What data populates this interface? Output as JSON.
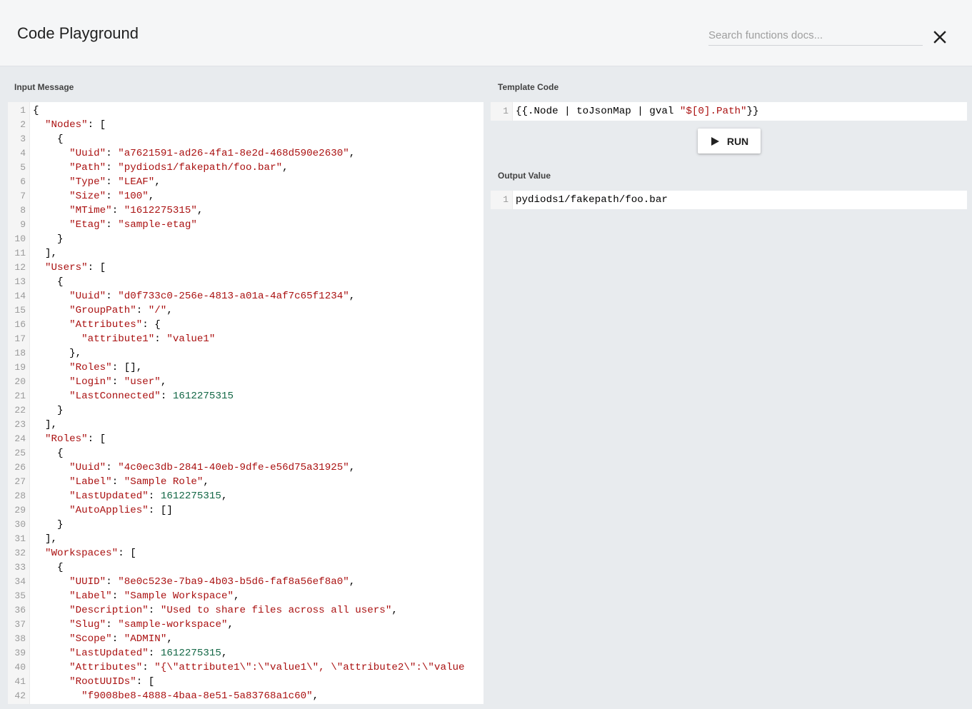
{
  "header": {
    "title": "Code Playground",
    "search_placeholder": "Search functions docs..."
  },
  "input": {
    "label": "Input Message",
    "lines": [
      [
        [
          "p",
          "{"
        ]
      ],
      [
        [
          "p",
          "  "
        ],
        [
          "k",
          "\"Nodes\""
        ],
        [
          "p",
          ": ["
        ]
      ],
      [
        [
          "p",
          "    {"
        ]
      ],
      [
        [
          "p",
          "      "
        ],
        [
          "k",
          "\"Uuid\""
        ],
        [
          "p",
          ": "
        ],
        [
          "s",
          "\"a7621591-ad26-4fa1-8e2d-468d590e2630\""
        ],
        [
          "p",
          ","
        ]
      ],
      [
        [
          "p",
          "      "
        ],
        [
          "k",
          "\"Path\""
        ],
        [
          "p",
          ": "
        ],
        [
          "s",
          "\"pydiods1/fakepath/foo.bar\""
        ],
        [
          "p",
          ","
        ]
      ],
      [
        [
          "p",
          "      "
        ],
        [
          "k",
          "\"Type\""
        ],
        [
          "p",
          ": "
        ],
        [
          "s",
          "\"LEAF\""
        ],
        [
          "p",
          ","
        ]
      ],
      [
        [
          "p",
          "      "
        ],
        [
          "k",
          "\"Size\""
        ],
        [
          "p",
          ": "
        ],
        [
          "s",
          "\"100\""
        ],
        [
          "p",
          ","
        ]
      ],
      [
        [
          "p",
          "      "
        ],
        [
          "k",
          "\"MTime\""
        ],
        [
          "p",
          ": "
        ],
        [
          "s",
          "\"1612275315\""
        ],
        [
          "p",
          ","
        ]
      ],
      [
        [
          "p",
          "      "
        ],
        [
          "k",
          "\"Etag\""
        ],
        [
          "p",
          ": "
        ],
        [
          "s",
          "\"sample-etag\""
        ]
      ],
      [
        [
          "p",
          "    }"
        ]
      ],
      [
        [
          "p",
          "  ],"
        ]
      ],
      [
        [
          "p",
          "  "
        ],
        [
          "k",
          "\"Users\""
        ],
        [
          "p",
          ": ["
        ]
      ],
      [
        [
          "p",
          "    {"
        ]
      ],
      [
        [
          "p",
          "      "
        ],
        [
          "k",
          "\"Uuid\""
        ],
        [
          "p",
          ": "
        ],
        [
          "s",
          "\"d0f733c0-256e-4813-a01a-4af7c65f1234\""
        ],
        [
          "p",
          ","
        ]
      ],
      [
        [
          "p",
          "      "
        ],
        [
          "k",
          "\"GroupPath\""
        ],
        [
          "p",
          ": "
        ],
        [
          "s",
          "\"/\""
        ],
        [
          "p",
          ","
        ]
      ],
      [
        [
          "p",
          "      "
        ],
        [
          "k",
          "\"Attributes\""
        ],
        [
          "p",
          ": {"
        ]
      ],
      [
        [
          "p",
          "        "
        ],
        [
          "k",
          "\"attribute1\""
        ],
        [
          "p",
          ": "
        ],
        [
          "s",
          "\"value1\""
        ]
      ],
      [
        [
          "p",
          "      },"
        ]
      ],
      [
        [
          "p",
          "      "
        ],
        [
          "k",
          "\"Roles\""
        ],
        [
          "p",
          ": [],"
        ]
      ],
      [
        [
          "p",
          "      "
        ],
        [
          "k",
          "\"Login\""
        ],
        [
          "p",
          ": "
        ],
        [
          "s",
          "\"user\""
        ],
        [
          "p",
          ","
        ]
      ],
      [
        [
          "p",
          "      "
        ],
        [
          "k",
          "\"LastConnected\""
        ],
        [
          "p",
          ": "
        ],
        [
          "n",
          "1612275315"
        ]
      ],
      [
        [
          "p",
          "    }"
        ]
      ],
      [
        [
          "p",
          "  ],"
        ]
      ],
      [
        [
          "p",
          "  "
        ],
        [
          "k",
          "\"Roles\""
        ],
        [
          "p",
          ": ["
        ]
      ],
      [
        [
          "p",
          "    {"
        ]
      ],
      [
        [
          "p",
          "      "
        ],
        [
          "k",
          "\"Uuid\""
        ],
        [
          "p",
          ": "
        ],
        [
          "s",
          "\"4c0ec3db-2841-40eb-9dfe-e56d75a31925\""
        ],
        [
          "p",
          ","
        ]
      ],
      [
        [
          "p",
          "      "
        ],
        [
          "k",
          "\"Label\""
        ],
        [
          "p",
          ": "
        ],
        [
          "s",
          "\"Sample Role\""
        ],
        [
          "p",
          ","
        ]
      ],
      [
        [
          "p",
          "      "
        ],
        [
          "k",
          "\"LastUpdated\""
        ],
        [
          "p",
          ": "
        ],
        [
          "n",
          "1612275315"
        ],
        [
          "p",
          ","
        ]
      ],
      [
        [
          "p",
          "      "
        ],
        [
          "k",
          "\"AutoApplies\""
        ],
        [
          "p",
          ": []"
        ]
      ],
      [
        [
          "p",
          "    }"
        ]
      ],
      [
        [
          "p",
          "  ],"
        ]
      ],
      [
        [
          "p",
          "  "
        ],
        [
          "k",
          "\"Workspaces\""
        ],
        [
          "p",
          ": ["
        ]
      ],
      [
        [
          "p",
          "    {"
        ]
      ],
      [
        [
          "p",
          "      "
        ],
        [
          "k",
          "\"UUID\""
        ],
        [
          "p",
          ": "
        ],
        [
          "s",
          "\"8e0c523e-7ba9-4b03-b5d6-faf8a56ef8a0\""
        ],
        [
          "p",
          ","
        ]
      ],
      [
        [
          "p",
          "      "
        ],
        [
          "k",
          "\"Label\""
        ],
        [
          "p",
          ": "
        ],
        [
          "s",
          "\"Sample Workspace\""
        ],
        [
          "p",
          ","
        ]
      ],
      [
        [
          "p",
          "      "
        ],
        [
          "k",
          "\"Description\""
        ],
        [
          "p",
          ": "
        ],
        [
          "s",
          "\"Used to share files across all users\""
        ],
        [
          "p",
          ","
        ]
      ],
      [
        [
          "p",
          "      "
        ],
        [
          "k",
          "\"Slug\""
        ],
        [
          "p",
          ": "
        ],
        [
          "s",
          "\"sample-workspace\""
        ],
        [
          "p",
          ","
        ]
      ],
      [
        [
          "p",
          "      "
        ],
        [
          "k",
          "\"Scope\""
        ],
        [
          "p",
          ": "
        ],
        [
          "s",
          "\"ADMIN\""
        ],
        [
          "p",
          ","
        ]
      ],
      [
        [
          "p",
          "      "
        ],
        [
          "k",
          "\"LastUpdated\""
        ],
        [
          "p",
          ": "
        ],
        [
          "n",
          "1612275315"
        ],
        [
          "p",
          ","
        ]
      ],
      [
        [
          "p",
          "      "
        ],
        [
          "k",
          "\"Attributes\""
        ],
        [
          "p",
          ": "
        ],
        [
          "s",
          "\"{\\\"attribute1\\\":\\\"value1\\\", \\\"attribute2\\\":\\\"value"
        ]
      ],
      [
        [
          "p",
          "      "
        ],
        [
          "k",
          "\"RootUUIDs\""
        ],
        [
          "p",
          ": ["
        ]
      ],
      [
        [
          "p",
          "        "
        ],
        [
          "s",
          "\"f9008be8-4888-4baa-8e51-5a83768a1c60\""
        ],
        [
          "p",
          ","
        ]
      ]
    ]
  },
  "template": {
    "label": "Template Code",
    "lines": [
      [
        [
          "p",
          "{{.Node | toJsonMap | gval "
        ],
        [
          "s",
          "\"$[0].Path\""
        ],
        [
          "p",
          "}}"
        ]
      ]
    ]
  },
  "run_button": {
    "label": "RUN"
  },
  "output": {
    "label": "Output Value",
    "lines": [
      [
        [
          "p",
          "pydiods1/fakepath/foo.bar"
        ]
      ]
    ]
  },
  "colors": {
    "key": "#aa1111",
    "string": "#aa1111",
    "number": "#116644"
  }
}
